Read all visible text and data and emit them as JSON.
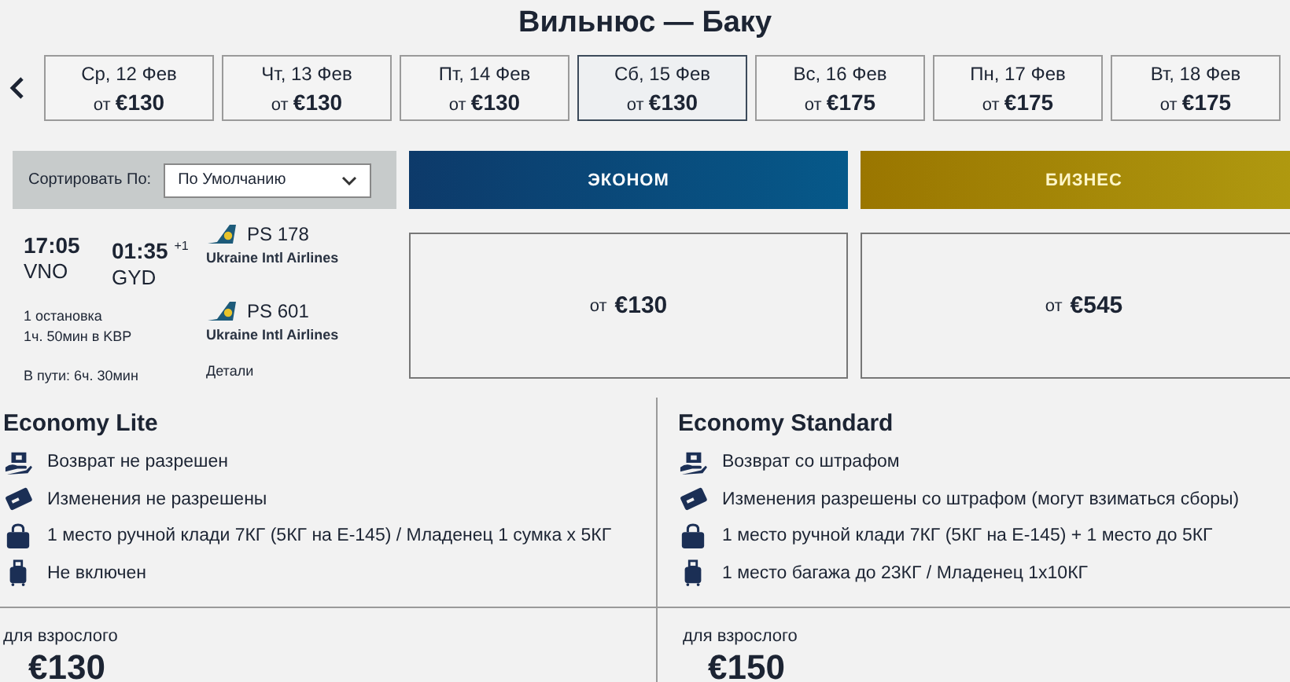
{
  "title": "Вильнюс — Баку",
  "dates": [
    {
      "day": "Ср, 12 Фев",
      "from": "от",
      "price": "€130",
      "selected": false
    },
    {
      "day": "Чт, 13 Фев",
      "from": "от",
      "price": "€130",
      "selected": false
    },
    {
      "day": "Пт, 14 Фев",
      "from": "от",
      "price": "€130",
      "selected": false
    },
    {
      "day": "Сб, 15 Фев",
      "from": "от",
      "price": "€130",
      "selected": true
    },
    {
      "day": "Вс, 16 Фев",
      "from": "от",
      "price": "€175",
      "selected": false
    },
    {
      "day": "Пн, 17 Фев",
      "from": "от",
      "price": "€175",
      "selected": false
    },
    {
      "day": "Вт, 18 Фев",
      "from": "от",
      "price": "€175",
      "selected": false
    }
  ],
  "sort": {
    "label": "Сортировать По:",
    "value": "По Умолчанию"
  },
  "flight": {
    "depart_time": "17:05",
    "arrive_time": "01:35",
    "day_offset": "+1",
    "origin": "VNO",
    "destination": "GYD",
    "stops": "1 остановка",
    "layover": "1ч. 50мин в KBP",
    "duration": "В пути: 6ч. 30мин",
    "details_link": "Детали",
    "segments": [
      {
        "flight_no": "PS 178",
        "airline": "Ukraine Intl Airlines"
      },
      {
        "flight_no": "PS 601",
        "airline": "Ukraine Intl Airlines"
      }
    ]
  },
  "cabins": [
    {
      "kind": "economy",
      "label": "ЭКОНОМ",
      "from": "от",
      "price": "€130"
    },
    {
      "kind": "business",
      "label": "БИЗНЕС",
      "from": "от",
      "price": "€545"
    }
  ],
  "fares": [
    {
      "name": "Economy Lite",
      "features": [
        {
          "kind": "refund",
          "text": "Возврат не разрешен"
        },
        {
          "kind": "change",
          "text": "Изменения не разрешены"
        },
        {
          "kind": "cabin_bag",
          "text": "1 место ручной клади 7КГ (5КГ на E-145) / Младенец 1 сумка х 5КГ"
        },
        {
          "kind": "checked_bag",
          "text": "Не включен"
        }
      ],
      "price_label": "для взрослого",
      "price": "€130"
    },
    {
      "name": "Economy Standard",
      "features": [
        {
          "kind": "refund",
          "text": "Возврат со штрафом"
        },
        {
          "kind": "change",
          "text": "Изменения разрешены со штрафом (могут взиматься сборы)"
        },
        {
          "kind": "cabin_bag",
          "text": "1 место ручной клади 7КГ (5КГ на E-145) + 1 место до 5КГ"
        },
        {
          "kind": "checked_bag",
          "text": "1 место багажа до 23КГ / Младенец 1x10КГ"
        }
      ],
      "price_label": "для взрослого",
      "price": "€150"
    }
  ]
}
